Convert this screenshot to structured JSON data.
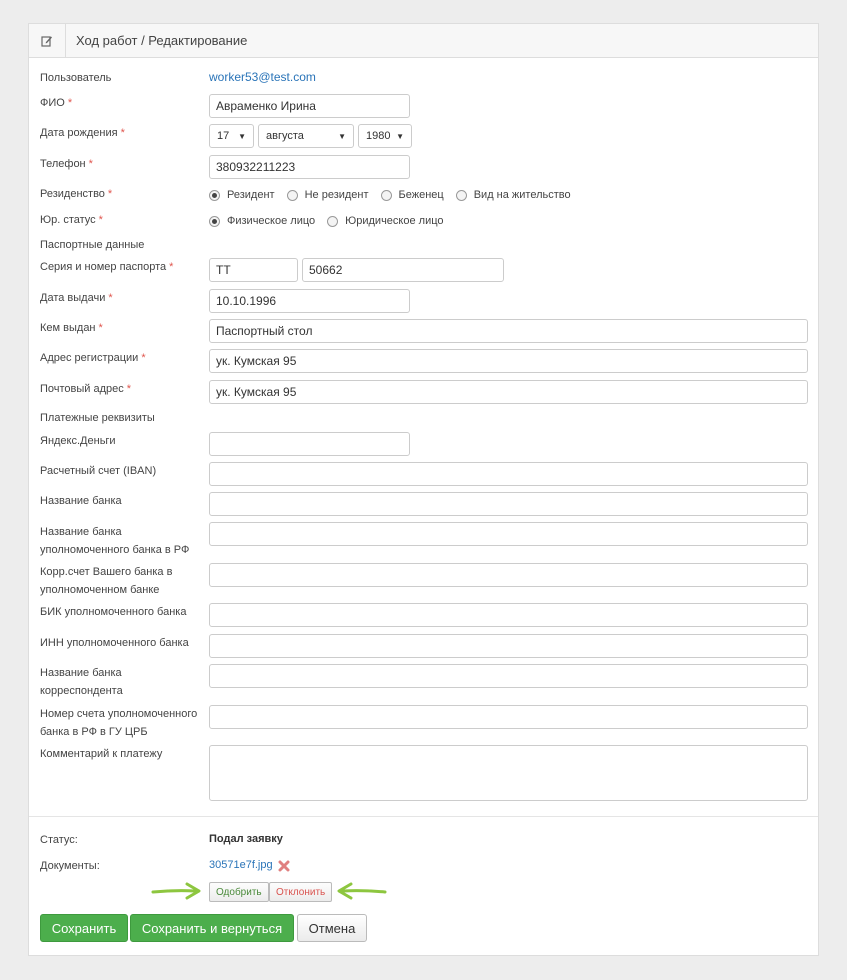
{
  "header": {
    "title": "Ход работ / Редактирование",
    "icon": "edit-icon"
  },
  "user": {
    "label": "Пользователь",
    "value": "worker53@test.com"
  },
  "fio": {
    "label": "ФИО",
    "value": "Авраменко Ирина"
  },
  "birth": {
    "label": "Дата рождения",
    "day": "17",
    "month": "августа",
    "year": "1980"
  },
  "phone": {
    "label": "Телефон",
    "value": "380932211223"
  },
  "residency": {
    "label": "Резиденство",
    "options": [
      "Резидент",
      "Не резидент",
      "Беженец",
      "Вид на жительство"
    ],
    "selected": "Резидент"
  },
  "legal": {
    "label": "Юр. статус",
    "options": [
      "Физическое лицо",
      "Юридическое лицо"
    ],
    "selected": "Физическое лицо"
  },
  "passport_section": "Паспортные данные",
  "passport": {
    "label": "Серия и номер паспорта",
    "series": "ТТ",
    "number": "50662"
  },
  "issue_date": {
    "label": "Дата выдачи",
    "value": "10.10.1996"
  },
  "issued_by": {
    "label": "Кем выдан",
    "value": "Паспортный стол"
  },
  "reg_address": {
    "label": "Адрес регистрации",
    "value": "ук. Кумская 95"
  },
  "post_address": {
    "label": "Почтовый адрес",
    "value": "ук. Кумская 95"
  },
  "payment_section": "Платежные реквизиты",
  "payment": {
    "yandex": "Яндекс.Деньги",
    "iban": "Расчетный счет (IBAN)",
    "bank_name": "Название банка",
    "auth_bank_l1": "Название банка",
    "auth_bank_l2": "уполномоченного банка в РФ",
    "corr_l1": "Корр.счет Вашего банка в",
    "corr_l2": "уполномоченном банке",
    "bik": "БИК уполномоченного банка",
    "inn": "ИНН уполномоченного банка",
    "corr_bank_l1": "Название банка",
    "corr_bank_l2": "корреспондента",
    "acc_l1": "Номер счета уполномоченного",
    "acc_l2": "банка в РФ в ГУ ЦРБ",
    "comment": "Комментарий к платежу"
  },
  "status": {
    "label": "Статус:",
    "value": "Подал заявку"
  },
  "documents": {
    "label": "Документы:",
    "file": "30571e7f.jpg",
    "approve": "Одобрить",
    "reject": "Отклонить"
  },
  "actions": {
    "save": "Сохранить",
    "save_return": "Сохранить и вернуться",
    "cancel": "Отмена"
  },
  "colors": {
    "accent_green": "#4cae4c",
    "link_blue": "#2a74b8",
    "required_red": "#e0554d",
    "arrow_green": "#8dc63f"
  }
}
